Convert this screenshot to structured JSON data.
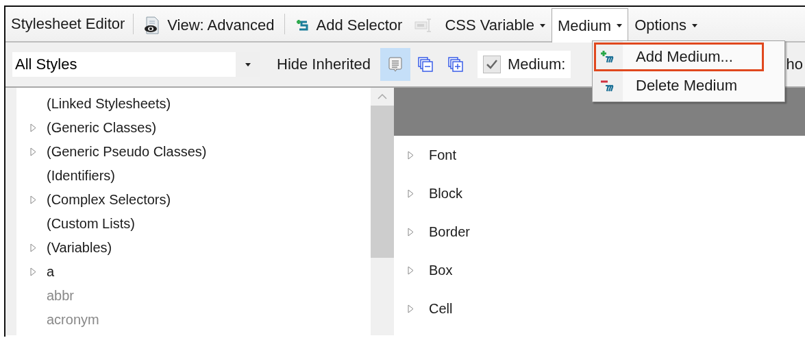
{
  "toolbar": {
    "items": [
      {
        "kind": "label",
        "label": "Stylesheet Editor"
      },
      {
        "kind": "separator"
      },
      {
        "kind": "button",
        "label": "View: Advanced",
        "disabled": false
      },
      {
        "kind": "separator"
      },
      {
        "kind": "button",
        "label": "Add Selector",
        "disabled": false
      },
      {
        "kind": "button",
        "disabled": true
      },
      {
        "kind": "dropdown",
        "label": "CSS Variable",
        "open": false
      },
      {
        "kind": "dropdown",
        "label": "Medium",
        "open": true
      },
      {
        "kind": "dropdown",
        "label": "Options",
        "open": false
      }
    ]
  },
  "filter_bar": {
    "style_select": {
      "value": "All Styles"
    },
    "hide_inherited": {
      "label": "Hide Inherited"
    },
    "view_buttons": [
      {
        "selected": true
      },
      {
        "selected": false
      },
      {
        "selected": false
      }
    ],
    "medium_checkbox": {
      "label": "Medium:",
      "checked": true
    },
    "column_3": "ho"
  },
  "medium_menu": {
    "items": [
      {
        "label": "Add Medium...",
        "highlighted": true
      },
      {
        "label": "Delete Medium",
        "highlighted": false
      }
    ]
  },
  "style_tree": {
    "items": [
      {
        "label": "(Linked Stylesheets)",
        "expandable": false,
        "greyed": false
      },
      {
        "label": "(Generic Classes)",
        "expandable": true,
        "greyed": false
      },
      {
        "label": "(Generic Pseudo Classes)",
        "expandable": true,
        "greyed": false
      },
      {
        "label": "(Identifiers)",
        "expandable": false,
        "greyed": false
      },
      {
        "label": "(Complex Selectors)",
        "expandable": true,
        "greyed": false
      },
      {
        "label": "(Custom Lists)",
        "expandable": false,
        "greyed": false
      },
      {
        "label": "(Variables)",
        "expandable": true,
        "greyed": false
      },
      {
        "label": "a",
        "expandable": true,
        "greyed": false
      },
      {
        "label": "abbr",
        "expandable": false,
        "greyed": true
      },
      {
        "label": "acronym",
        "expandable": false,
        "greyed": true
      }
    ]
  },
  "properties": {
    "groups": [
      {
        "label": "Font",
        "expanded": false
      },
      {
        "label": "Block",
        "expanded": false
      },
      {
        "label": "Border",
        "expanded": false
      },
      {
        "label": "Box",
        "expanded": false
      },
      {
        "label": "Cell",
        "expanded": false
      }
    ]
  }
}
